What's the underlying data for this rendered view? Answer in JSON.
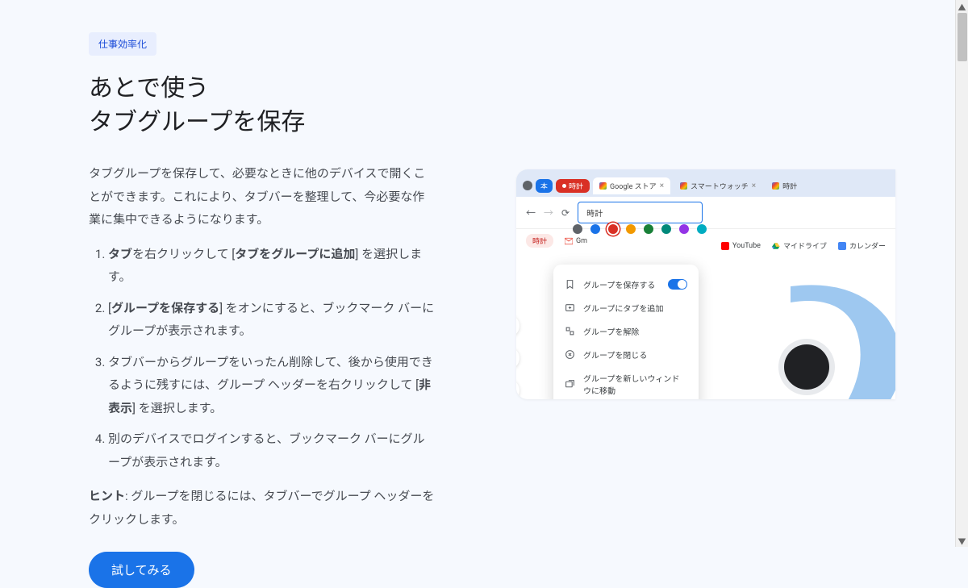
{
  "badge": "仕事効率化",
  "headline_l1": "あとで使う",
  "headline_l2": "タブグループを保存",
  "description": "タブグループを保存して、必要なときに他のデバイスで開くことができます。これにより、タブバーを整理して、今必要な作業に集中できるようになります。",
  "steps": {
    "s1a": "タブ",
    "s1b": "を右クリックして [",
    "s1c": "タブをグループに追加",
    "s1d": "] を選択します。",
    "s2a": "[",
    "s2b": "グループを保存する",
    "s2c": "] をオンにすると、ブックマーク バーにグループが表示されます。",
    "s3a": "タブバーからグループをいったん削除して、後から使用できるように残すには、グループ ヘッダーを右クリックして [",
    "s3b": "非表示",
    "s3c": "] を選択します。",
    "s4": "別のデバイスでログインすると、ブックマーク バーにグループが表示されます。"
  },
  "hint_label": "ヒント",
  "hint_text": ": グループを閉じるには、タブバーでグループ ヘッダーをクリックします。",
  "cta": "試してみる",
  "mock": {
    "tab_group1": "本",
    "tab_group2": "時計",
    "tab1": "Google ストア",
    "tab2": "スマートウォッチ",
    "tab3": "時計",
    "search_value": "時計",
    "bookmark_group": "時計",
    "bm_gmail": "Gm",
    "bm_youtube": "YouTube",
    "bm_drive": "マイドライブ",
    "bm_calendar": "カレンダー",
    "menu": {
      "save": "グループを保存する",
      "add": "グループにタブを追加",
      "ungroup": "グループを解除",
      "close": "グループを閉じる",
      "move": "グループを新しいウィンドウに移動"
    }
  }
}
